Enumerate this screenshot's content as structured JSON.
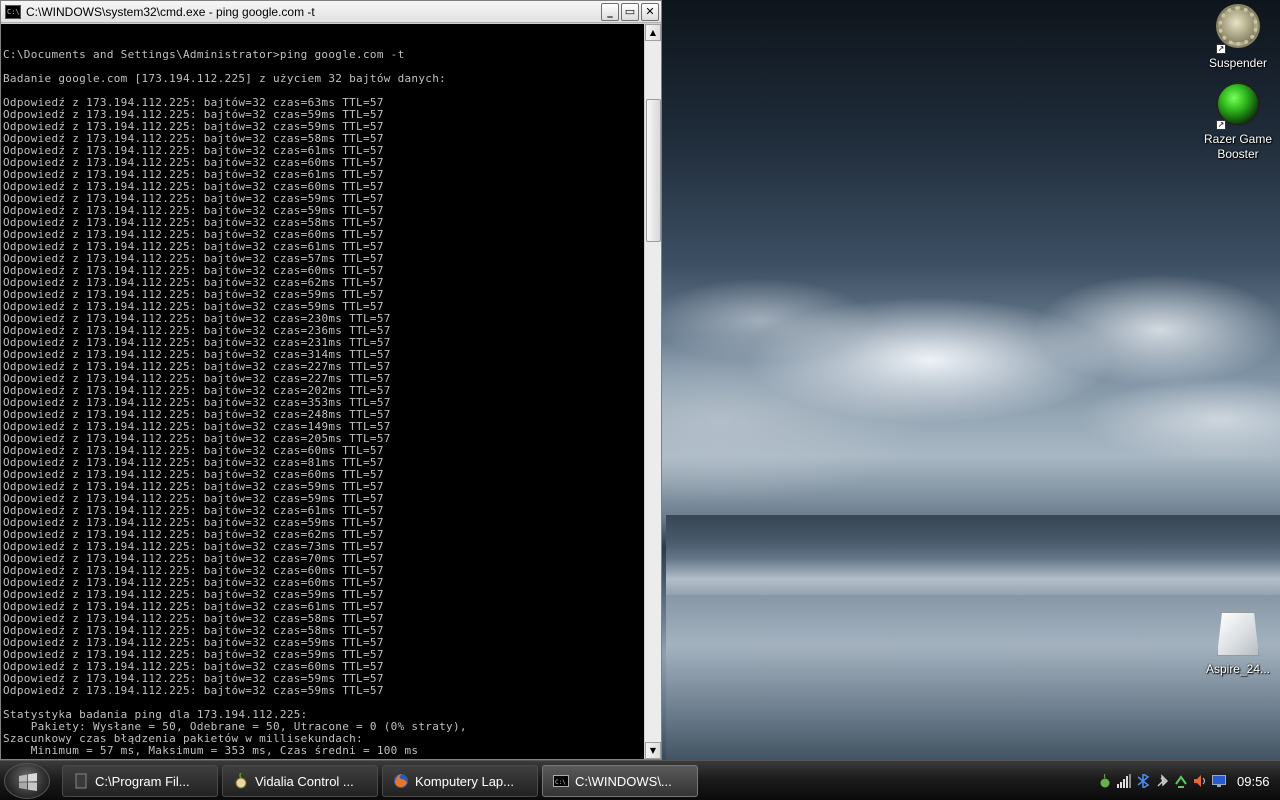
{
  "desktop": {
    "icons": [
      {
        "label": "Suspender"
      },
      {
        "label": "Razer Game Booster"
      },
      {
        "label": "Aspire_24..."
      }
    ]
  },
  "cmd": {
    "title": "C:\\WINDOWS\\system32\\cmd.exe - ping google.com -t",
    "buttons": {
      "minimize": "_",
      "maximize": "▭",
      "close": "✕"
    },
    "prompt": "C:\\Documents and Settings\\Administrator>ping google.com -t",
    "header": "Badanie google.com [173.194.112.225] z użyciem 32 bajtów danych:",
    "reply_prefix": "Odpowiedź z 173.194.112.225: bajtów=32 czas=",
    "replies": [
      "63ms TTL=57",
      "59ms TTL=57",
      "59ms TTL=57",
      "58ms TTL=57",
      "61ms TTL=57",
      "60ms TTL=57",
      "61ms TTL=57",
      "60ms TTL=57",
      "59ms TTL=57",
      "59ms TTL=57",
      "58ms TTL=57",
      "60ms TTL=57",
      "61ms TTL=57",
      "57ms TTL=57",
      "60ms TTL=57",
      "62ms TTL=57",
      "59ms TTL=57",
      "59ms TTL=57",
      "230ms TTL=57",
      "236ms TTL=57",
      "231ms TTL=57",
      "314ms TTL=57",
      "227ms TTL=57",
      "227ms TTL=57",
      "202ms TTL=57",
      "353ms TTL=57",
      "248ms TTL=57",
      "149ms TTL=57",
      "205ms TTL=57",
      "60ms TTL=57",
      "81ms TTL=57",
      "60ms TTL=57",
      "59ms TTL=57",
      "59ms TTL=57",
      "61ms TTL=57",
      "59ms TTL=57",
      "62ms TTL=57",
      "73ms TTL=57",
      "70ms TTL=57",
      "60ms TTL=57",
      "60ms TTL=57",
      "59ms TTL=57",
      "61ms TTL=57",
      "58ms TTL=57",
      "58ms TTL=57",
      "59ms TTL=57",
      "59ms TTL=57",
      "60ms TTL=57",
      "59ms TTL=57",
      "59ms TTL=57"
    ],
    "stats": [
      "Statystyka badania ping dla 173.194.112.225:",
      "    Pakiety: Wysłane = 50, Odebrane = 50, Utracone = 0 (0% straty),",
      "Szacunkowy czas błądzenia pakietów w millisekundach:",
      "    Minimum = 57 ms, Maksimum = 353 ms, Czas średni = 100 ms"
    ]
  },
  "taskbar": {
    "tasks": [
      {
        "label": "C:\\Program Fil..."
      },
      {
        "label": "Vidalia Control ..."
      },
      {
        "label": "Komputery Lap..."
      },
      {
        "label": "C:\\WINDOWS\\..."
      }
    ],
    "clock": "09:56"
  }
}
